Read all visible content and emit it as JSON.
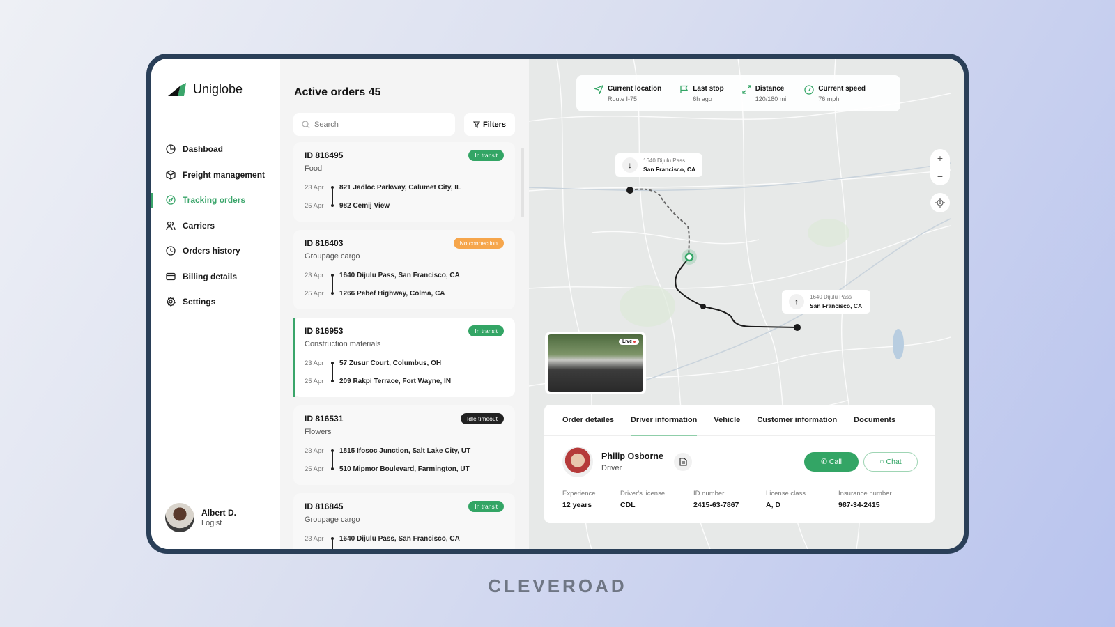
{
  "app": {
    "name": "Uniglobe"
  },
  "sidebar": {
    "items": [
      {
        "label": "Dashboad",
        "icon": "pie-chart-icon",
        "active": false
      },
      {
        "label": "Freight management",
        "icon": "package-icon",
        "active": false
      },
      {
        "label": "Tracking orders",
        "icon": "compass-icon",
        "active": true
      },
      {
        "label": "Carriers",
        "icon": "users-icon",
        "active": false
      },
      {
        "label": "Orders history",
        "icon": "clock-icon",
        "active": false
      },
      {
        "label": "Billing details",
        "icon": "credit-card-icon",
        "active": false
      },
      {
        "label": "Settings",
        "icon": "gear-icon",
        "active": false
      }
    ],
    "user": {
      "name": "Albert D.",
      "role": "Logist"
    }
  },
  "orders": {
    "title": "Active orders 45",
    "search_placeholder": "Search",
    "filters_label": "Filters",
    "cards": [
      {
        "id": "ID 816495",
        "type": "Food",
        "status": "In transit",
        "status_color": "#33a565",
        "from_date": "23 Apr",
        "from": "821 Jadloc Parkway, Calumet City, IL",
        "to_date": "25 Apr",
        "to": "982 Cemij View"
      },
      {
        "id": "ID 816403",
        "type": "Groupage cargo",
        "status": "No connection",
        "status_color": "#f6a64c",
        "from_date": "23 Apr",
        "from": "1640 Dijulu Pass, San Francisco, CA",
        "to_date": "25 Apr",
        "to": "1266 Pebef Highway, Colma,  CA"
      },
      {
        "id": "ID 816953",
        "type": "Construction materials",
        "status": "In transit",
        "status_color": "#33a565",
        "from_date": "23 Apr",
        "from": "57 Zusur Court, Columbus, OH",
        "to_date": "25 Apr",
        "to": "209 Rakpi Terrace, Fort Wayne, IN",
        "selected": true
      },
      {
        "id": "ID 816531",
        "type": "Flowers",
        "status": "Idle timeout",
        "status_color": "#222222",
        "from_date": "23 Apr",
        "from": "1815 Ifosoc Junction, Salt Lake City, UT",
        "to_date": "25 Apr",
        "to": "510 Mipmor Boulevard, Farmington, UT"
      },
      {
        "id": "ID 816845",
        "type": "Groupage cargo",
        "status": "In transit",
        "status_color": "#33a565",
        "from_date": "23 Apr",
        "from": "1640 Dijulu Pass, San Francisco, CA",
        "to_date": "",
        "to": ""
      }
    ]
  },
  "map": {
    "stats": [
      {
        "title": "Current location",
        "value": "Route I-75",
        "icon": "navigation-icon"
      },
      {
        "title": "Last stop",
        "value": "6h ago",
        "icon": "flag-icon"
      },
      {
        "title": "Distance",
        "value": "120/180 mi",
        "icon": "expand-icon"
      },
      {
        "title": "Current speed",
        "value": "76 mph",
        "icon": "speedometer-icon"
      }
    ],
    "origin": {
      "line1": "1640 Dijulu Pass",
      "line2": "San Francisco, CA"
    },
    "destination": {
      "line1": "1640 Dijulu Pass",
      "line2": "San Francisco, CA"
    },
    "zoom_in": "+",
    "zoom_out": "−",
    "live_label": "Live"
  },
  "details": {
    "tabs": [
      {
        "label": "Order detailes",
        "active": false
      },
      {
        "label": "Driver information",
        "active": true
      },
      {
        "label": "Vehicle",
        "active": false
      },
      {
        "label": "Customer information",
        "active": false
      },
      {
        "label": "Documents",
        "active": false
      }
    ],
    "driver": {
      "name": "Philip Osborne",
      "role": "Driver"
    },
    "call_label": "Call",
    "chat_label": "Chat",
    "fields": [
      {
        "label": "Experience",
        "value": "12 years"
      },
      {
        "label": "Driver's license",
        "value": "CDL"
      },
      {
        "label": "ID number",
        "value": "2415-63-7867"
      },
      {
        "label": "License class",
        "value": "A, D"
      },
      {
        "label": "Insurance number",
        "value": "987-34-2415"
      }
    ]
  },
  "footer": {
    "brand": "CLEVEROAD"
  },
  "colors": {
    "accent": "#33a565",
    "frame": "#2a3f58",
    "warning": "#f6a64c"
  }
}
